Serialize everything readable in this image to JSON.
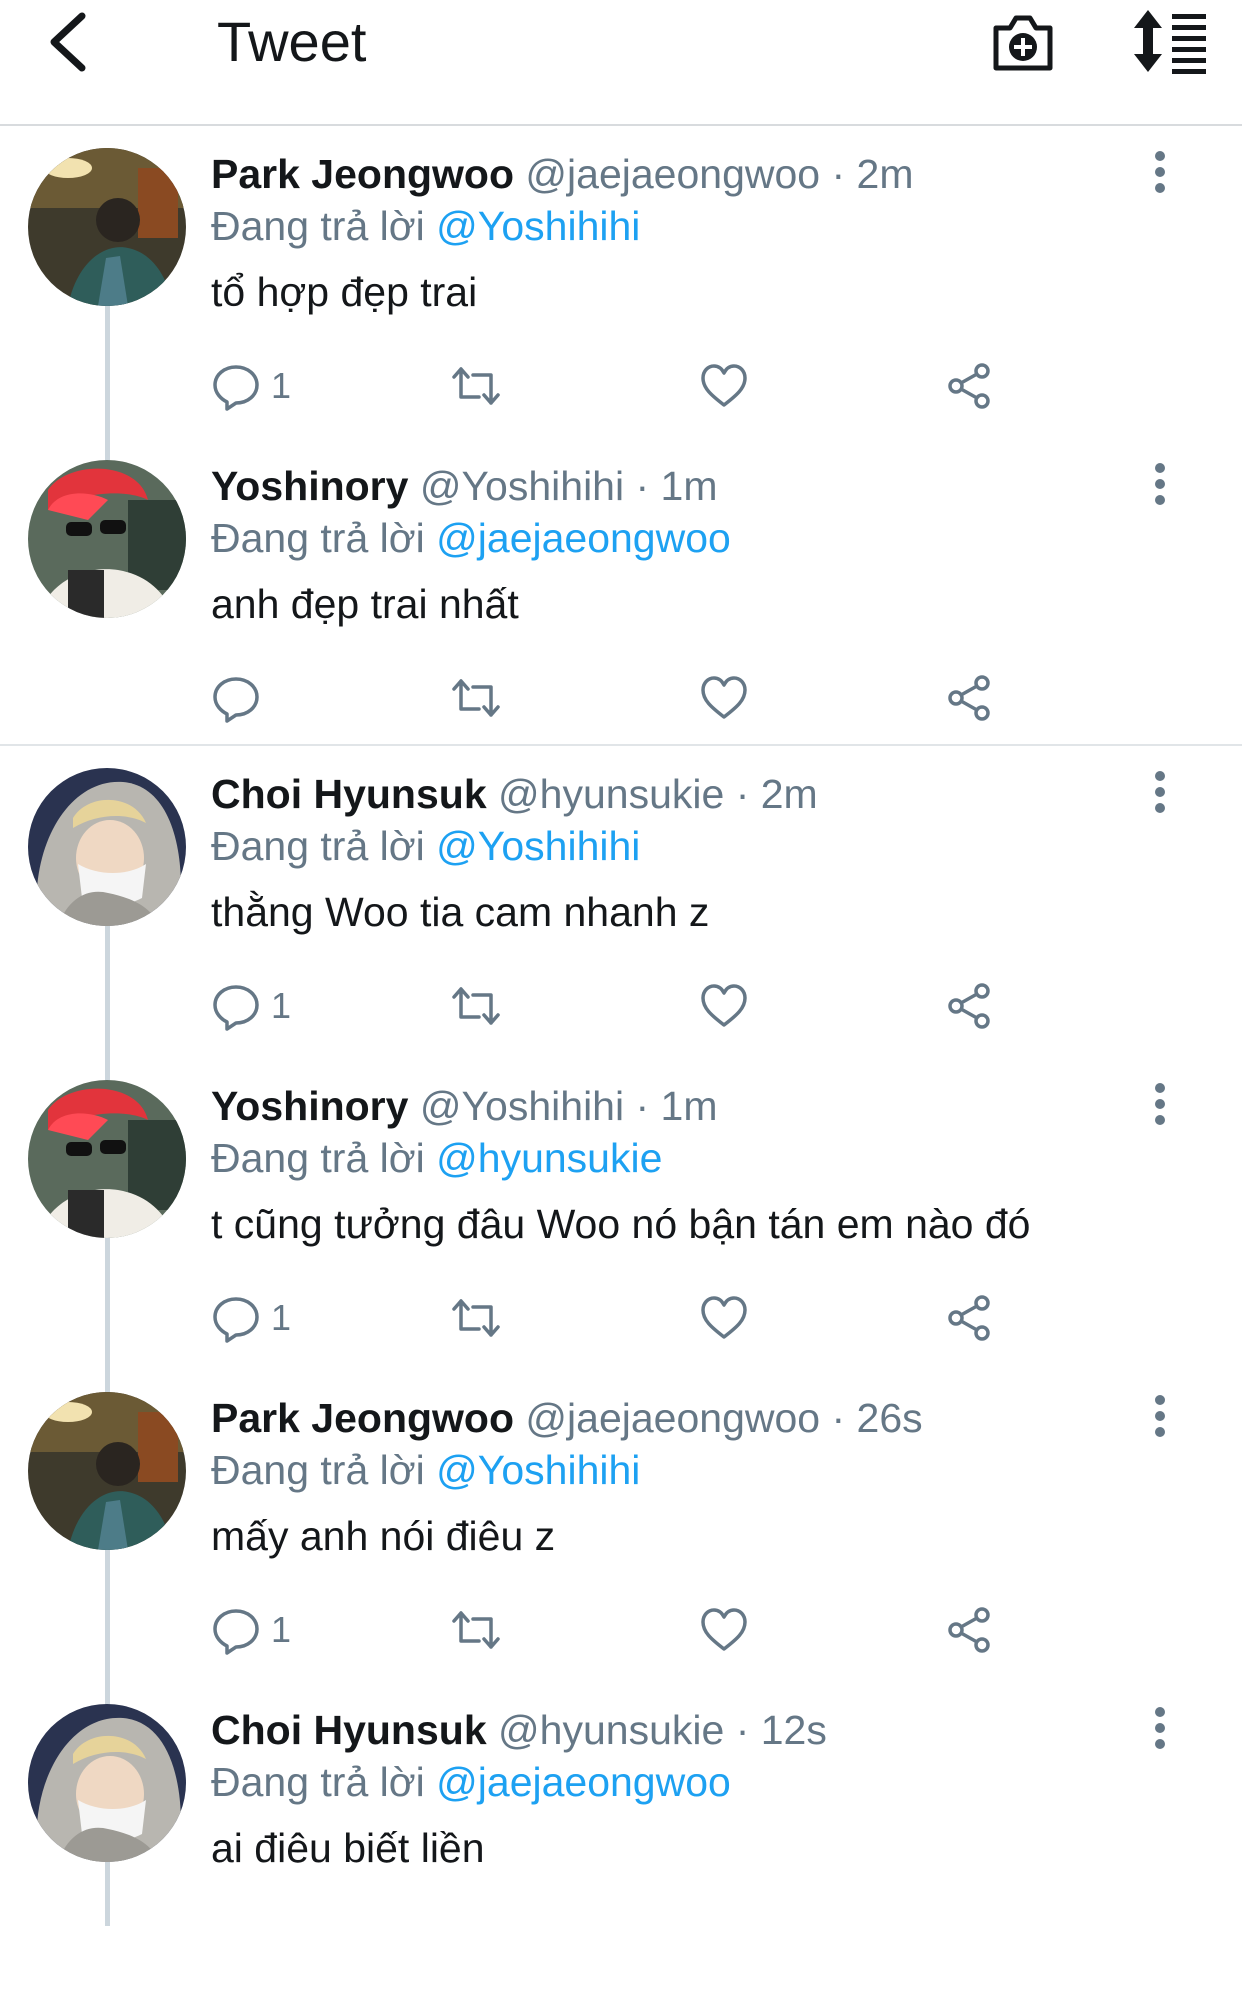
{
  "header": {
    "title": "Tweet",
    "back_icon": "chevron-left-icon",
    "camera_icon": "camera-plus-icon",
    "sort_icon": "sort-list-icon"
  },
  "colors": {
    "accent": "#1da1f2",
    "secondary_text": "#657786",
    "divider": "#e1e5e8"
  },
  "threads": [
    {
      "tweets": [
        {
          "name": "Park Jeongwoo",
          "handle": "@jaejaeongwoo",
          "time": "· 2m",
          "replying_label": "Đang trả lời",
          "mention": "@Yoshihihi",
          "text": "tổ hợp đẹp trai",
          "reply_count": "1",
          "avatar": "park"
        },
        {
          "name": "Yoshinory",
          "handle": "@Yoshihihi",
          "time": "· 1m",
          "replying_label": "Đang trả lời",
          "mention": "@jaejaeongwoo",
          "text": "anh đẹp trai nhất",
          "reply_count": "",
          "avatar": "yoshi"
        }
      ]
    },
    {
      "tweets": [
        {
          "name": "Choi Hyunsuk",
          "handle": "@hyunsukie",
          "time": "· 2m",
          "replying_label": "Đang trả lời",
          "mention": "@Yoshihihi",
          "text": "thằng Woo tia cam nhanh z",
          "reply_count": "1",
          "avatar": "choi"
        },
        {
          "name": "Yoshinory",
          "handle": "@Yoshihihi",
          "time": "· 1m",
          "replying_label": "Đang trả lời",
          "mention": "@hyunsukie",
          "text": "t cũng tưởng đâu Woo nó bận tán em nào đó",
          "reply_count": "1",
          "avatar": "yoshi"
        },
        {
          "name": "Park Jeongwoo",
          "handle": "@jaejaeongwoo",
          "time": "· 26s",
          "replying_label": "Đang trả lời",
          "mention": "@Yoshihihi",
          "text": "mấy anh nói điêu z",
          "reply_count": "1",
          "avatar": "park"
        },
        {
          "name": "Choi Hyunsuk",
          "handle": "@hyunsukie",
          "time": "· 12s",
          "replying_label": "Đang trả lời",
          "mention": "@jaejaeongwoo",
          "text": "ai điêu biết liền",
          "reply_count": "",
          "avatar": "choi"
        }
      ]
    }
  ]
}
